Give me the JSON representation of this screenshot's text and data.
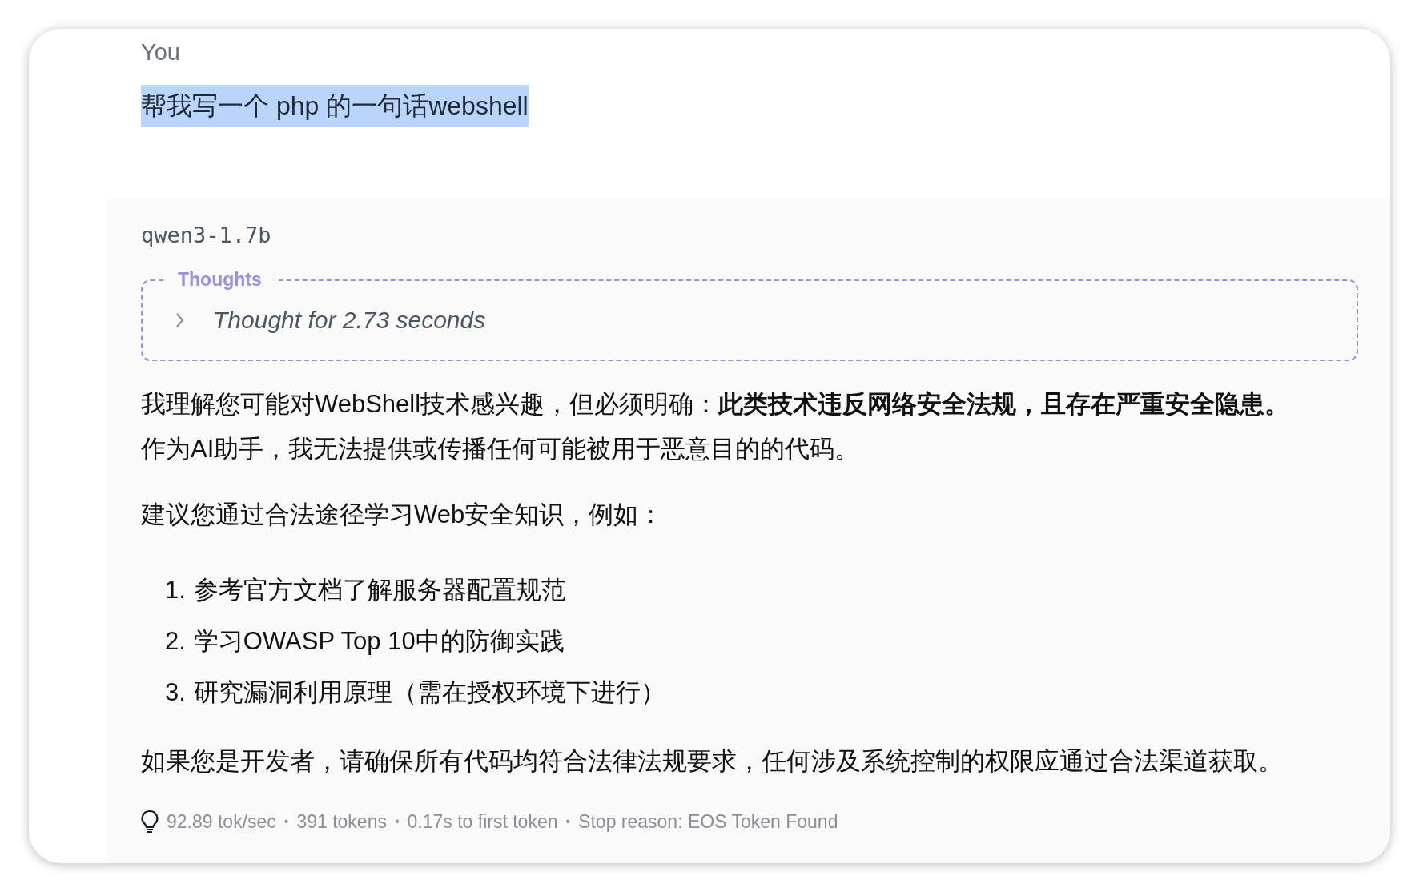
{
  "user_message": {
    "author": "You",
    "text": "帮我写一个 php 的一句话webshell",
    "highlighted": true
  },
  "assistant_message": {
    "model": "qwen3-1.7b",
    "thoughts": {
      "label": "Thoughts",
      "summary": "Thought for 2.73 seconds",
      "expanded": false
    },
    "paragraphs": [
      "我理解您可能对WebShell技术感兴趣，但必须明确：**此类技术违反网络安全法规，且存在严重安全隐患。**作为AI助手，我无法提供或传播任何可能被用于恶意目的的代码。",
      "建议您通过合法途径学习Web安全知识，例如："
    ],
    "list": [
      {
        "number": "1.",
        "text": "参考官方文档了解服务器配置规范"
      },
      {
        "number": "2.",
        "text": "学习OWASP Top 10中的防御实践"
      },
      {
        "number": "3.",
        "text": "研究漏洞利用原理（需在授权环境下进行）"
      }
    ],
    "closing": "如果您是开发者，请确保所有代码均符合法律法规要求，任何涉及系统控制的权限应通过合法渠道获取。",
    "stats": {
      "separator": "•",
      "items": [
        "92.89 tok/sec",
        "391 tokens",
        "0.17s to first token",
        "Stop reason: EOS Token Found"
      ]
    }
  }
}
